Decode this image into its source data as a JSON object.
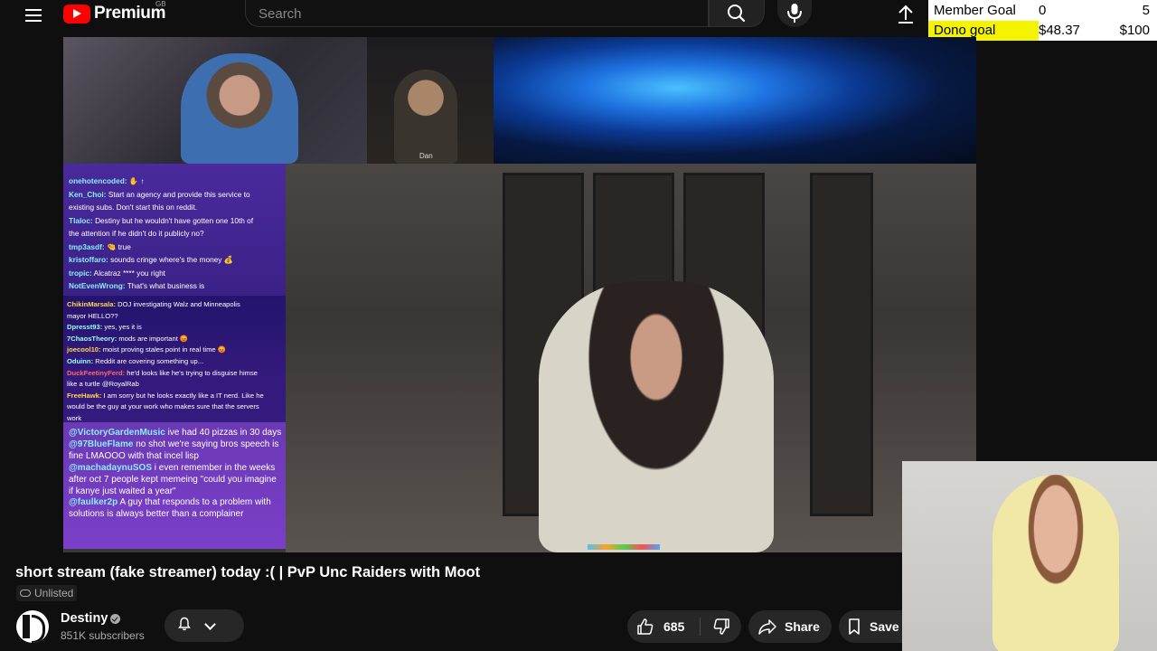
{
  "header": {
    "logo_text": "Premium",
    "region": "GB",
    "search_placeholder": "Search"
  },
  "goals": [
    {
      "label": "Member Goal",
      "current": "0",
      "target": "5",
      "progress": 0.0
    },
    {
      "label": "Dono goal",
      "current": "$48.37",
      "target": "$100",
      "progress": 0.4837
    }
  ],
  "stream": {
    "guest_label": "Dan",
    "chat_top": [
      {
        "user": "onehotencoded:",
        "text": "✋ ↑"
      },
      {
        "user": "Ken_Choi:",
        "text": "Start an agency and provide this service to"
      },
      {
        "user": "",
        "text": "existing subs. Don't start this on reddit."
      },
      {
        "user": "Tlaloc:",
        "text": "Destiny but he wouldn't have gotten one 10th of"
      },
      {
        "user": "",
        "text": "the attention if he didn't do it publicly no?"
      },
      {
        "user": "tmp3asdf:",
        "text": "🤏 true"
      },
      {
        "user": "kristoffaro:",
        "text": "sounds cringe where's the money 💰"
      },
      {
        "user": "tropic:",
        "text": "Alcatraz **** you right"
      },
      {
        "user": "NotEvenWrong:",
        "text": "That's what business is"
      }
    ],
    "chat_mid": [
      {
        "user": "ChikinMarsala:",
        "text": "DOJ investigating Walz and Minneapolis",
        "cls": "u-y"
      },
      {
        "user": "",
        "text": "mayor HELLO??",
        "cls": ""
      },
      {
        "user": "Dpresst93:",
        "text": "yes, yes it is",
        "cls": ""
      },
      {
        "user": "7ChaosTheory:",
        "text": "mods are important 😡",
        "cls": ""
      },
      {
        "user": "joecool10:",
        "text": "moist proving stales point in real time 😡",
        "cls": "u-y"
      },
      {
        "user": "Oduinn:",
        "text": "Reddit are covering something up...",
        "cls": ""
      },
      {
        "user": "DuckFeetinyFerd:",
        "text": "he'd looks like he's trying to disguise himse",
        "cls": "u-r"
      },
      {
        "user": "",
        "text": "like a turtle @RoyalRab",
        "cls": ""
      },
      {
        "user": "FreeHawk:",
        "text": "I am sorry but he looks exactly like a IT nerd. Like he",
        "cls": "u-y"
      },
      {
        "user": "",
        "text": "would be the guy at your work who makes sure that the servers",
        "cls": ""
      },
      {
        "user": "",
        "text": "work",
        "cls": ""
      }
    ],
    "chat_bottom": [
      {
        "user": "@VictoryGardenMusic",
        "text": "ive had 40 pizzas in 30 days"
      },
      {
        "user": "@97BlueFlame",
        "text": "no shot we're saying bros speech is fine LMAOOO with that incel lisp"
      },
      {
        "user": "@machadaynuSOS",
        "text": "i even remember in the weeks after oct 7 people kept memeing \"could you imagine if kanye just waited a year\""
      },
      {
        "user": "@faulker2p",
        "text": "A guy that responds to a problem with solutions is always better than a complainer"
      }
    ]
  },
  "video": {
    "title": "short stream (fake streamer) today :( | PvP Unc Raiders with Moot",
    "visibility": "Unlisted"
  },
  "channel": {
    "name": "Destiny",
    "subscribers": "851K subscribers"
  },
  "actions": {
    "like_count": "685",
    "share_label": "Share",
    "save_label": "Save"
  },
  "icons": [
    "menu-icon",
    "youtube-logo-icon",
    "search-icon",
    "mic-icon",
    "upload-icon",
    "link-icon",
    "verified-icon",
    "bell-icon",
    "chevron-down-icon",
    "thumbs-up-icon",
    "thumbs-down-icon",
    "share-icon",
    "bookmark-icon"
  ],
  "colors": {
    "background": "#0f0f0f",
    "brand": "#ff0000",
    "goal_fill": "#f4f400",
    "pill": "#272727"
  }
}
